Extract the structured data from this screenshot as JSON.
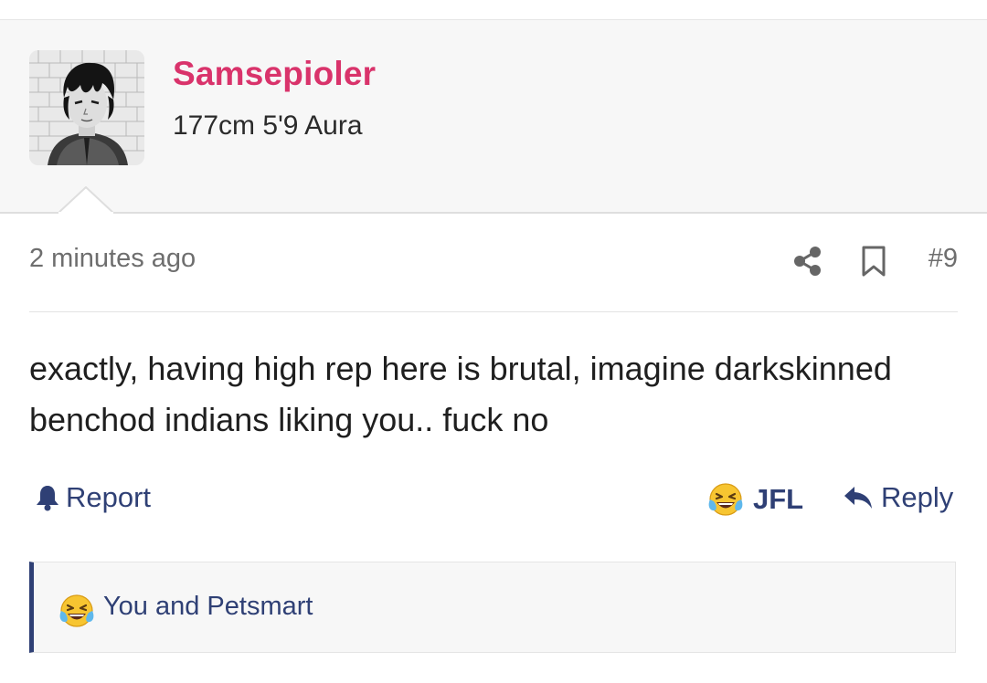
{
  "user": {
    "name": "Samsepioler",
    "title": "177cm 5'9 Aura"
  },
  "post": {
    "timestamp": "2 minutes ago",
    "number": "#9",
    "body": "exactly, having high rep here is brutal, imagine darkskinned benchod indians liking you.. fuck no"
  },
  "actions": {
    "report_label": "Report",
    "reaction_label": "JFL",
    "reply_label": "Reply"
  },
  "reactions": {
    "summary": "You and Petsmart"
  },
  "colors": {
    "username": "#d9336b",
    "link": "#2f4075",
    "muted": "#6e6e6e",
    "header_bg": "#f7f7f7"
  },
  "icons": {
    "share": "share-icon",
    "bookmark": "bookmark-icon",
    "report": "bell-icon",
    "reaction": "laughing-crying-emoji-icon",
    "reply": "reply-arrow-icon"
  }
}
